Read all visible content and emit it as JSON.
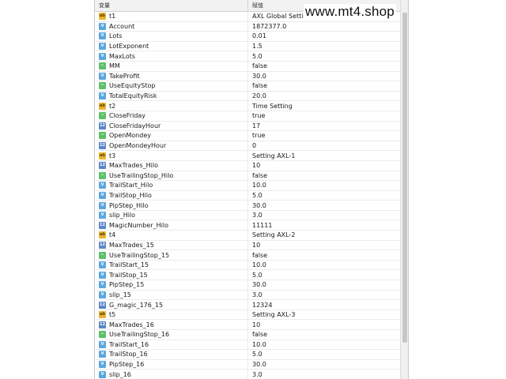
{
  "header": {
    "col_name": "变量",
    "col_value": "赋值"
  },
  "watermark": "www.mt4.shop",
  "rows": [
    {
      "icon": "ab",
      "name": "t1",
      "value": "AXL Global Setting"
    },
    {
      "icon": "v",
      "name": "Account",
      "value": "1872377.0"
    },
    {
      "icon": "v",
      "name": "Lots",
      "value": "0.01"
    },
    {
      "icon": "v",
      "name": "LotExponent",
      "value": "1.5"
    },
    {
      "icon": "v",
      "name": "MaxLots",
      "value": "5.0"
    },
    {
      "icon": "bool",
      "name": "MM",
      "value": "false"
    },
    {
      "icon": "v",
      "name": "TakeProfit",
      "value": "30.0"
    },
    {
      "icon": "bool",
      "name": "UseEquityStop",
      "value": "false"
    },
    {
      "icon": "v",
      "name": "TotalEquityRisk",
      "value": "20.0"
    },
    {
      "icon": "ab",
      "name": "t2",
      "value": "Time Setting"
    },
    {
      "icon": "bool",
      "name": "CloseFriday",
      "value": "true"
    },
    {
      "icon": "int",
      "name": "CloseFridayHour",
      "value": "17"
    },
    {
      "icon": "bool",
      "name": "OpenMondey",
      "value": "true"
    },
    {
      "icon": "int",
      "name": "OpenMondeyHour",
      "value": "0"
    },
    {
      "icon": "ab",
      "name": "t3",
      "value": "Setting AXL-1"
    },
    {
      "icon": "int",
      "name": "MaxTrades_Hilo",
      "value": "10"
    },
    {
      "icon": "bool",
      "name": "UseTrailingStop_Hilo",
      "value": "false"
    },
    {
      "icon": "v",
      "name": "TrailStart_Hilo",
      "value": "10.0"
    },
    {
      "icon": "v",
      "name": "TrailStop_Hilo",
      "value": "5.0"
    },
    {
      "icon": "v",
      "name": "PipStep_Hilo",
      "value": "30.0"
    },
    {
      "icon": "v",
      "name": "slip_Hilo",
      "value": "3.0"
    },
    {
      "icon": "int",
      "name": "MagicNumber_Hilo",
      "value": "11111"
    },
    {
      "icon": "ab",
      "name": "t4",
      "value": "Setting AXL-2"
    },
    {
      "icon": "int",
      "name": "MaxTrades_15",
      "value": "10"
    },
    {
      "icon": "bool",
      "name": "UseTrailingStop_15",
      "value": "false"
    },
    {
      "icon": "v",
      "name": "TrailStart_15",
      "value": "10.0"
    },
    {
      "icon": "v",
      "name": "TrailStop_15",
      "value": "5.0"
    },
    {
      "icon": "v",
      "name": "PipStep_15",
      "value": "30.0"
    },
    {
      "icon": "v",
      "name": "slip_15",
      "value": "3.0"
    },
    {
      "icon": "int",
      "name": "G_magic_176_15",
      "value": "12324"
    },
    {
      "icon": "ab",
      "name": "t5",
      "value": "Setting AXL-3"
    },
    {
      "icon": "int",
      "name": "MaxTrades_16",
      "value": "10"
    },
    {
      "icon": "bool",
      "name": "UseTrailingStop_16",
      "value": "false"
    },
    {
      "icon": "v",
      "name": "TrailStart_16",
      "value": "10.0"
    },
    {
      "icon": "v",
      "name": "TrailStop_16",
      "value": "5.0"
    },
    {
      "icon": "v",
      "name": "PipStep_16",
      "value": "30.0"
    },
    {
      "icon": "v",
      "name": "slip_16",
      "value": "3.0"
    }
  ]
}
